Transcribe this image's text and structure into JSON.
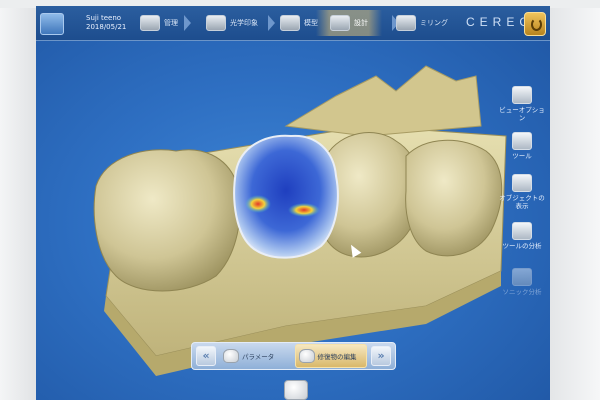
{
  "patient": {
    "name": "Suji teeno",
    "date": "2018/05/21"
  },
  "workflow": {
    "steps": [
      {
        "label": "管理",
        "state": "done"
      },
      {
        "label": "光学印象",
        "state": "done"
      },
      {
        "label": "模型",
        "state": "done"
      },
      {
        "label": "設計",
        "state": "active"
      },
      {
        "label": "ミリング",
        "state": "pending"
      }
    ]
  },
  "brand": "CEREC",
  "right_tools": [
    {
      "label": "ビューオプション",
      "enabled": true
    },
    {
      "label": "ツール",
      "enabled": true
    },
    {
      "label": "オブジェクトの表示",
      "enabled": true
    },
    {
      "label": "ツールの分析",
      "enabled": true
    },
    {
      "label": "ソニック分析",
      "enabled": false
    }
  ],
  "bottom_toolbar": {
    "prev_label": "«",
    "next_label": "»",
    "buttons": [
      {
        "label": "パラメータ",
        "active": false
      },
      {
        "label": "修復物の編集",
        "active": true
      }
    ]
  },
  "colors": {
    "background": "#2e6fc2",
    "topbar": "#1d4d8e",
    "model_stone": "#d8cf9a",
    "active_step": "#d6bc78",
    "contact_map_blue": "#1f3fbf",
    "contact_map_red": "#e23a2a"
  },
  "icons": {
    "power": "power-icon",
    "app": "app-menu-icon",
    "cursor": "mouse-cursor-icon"
  }
}
